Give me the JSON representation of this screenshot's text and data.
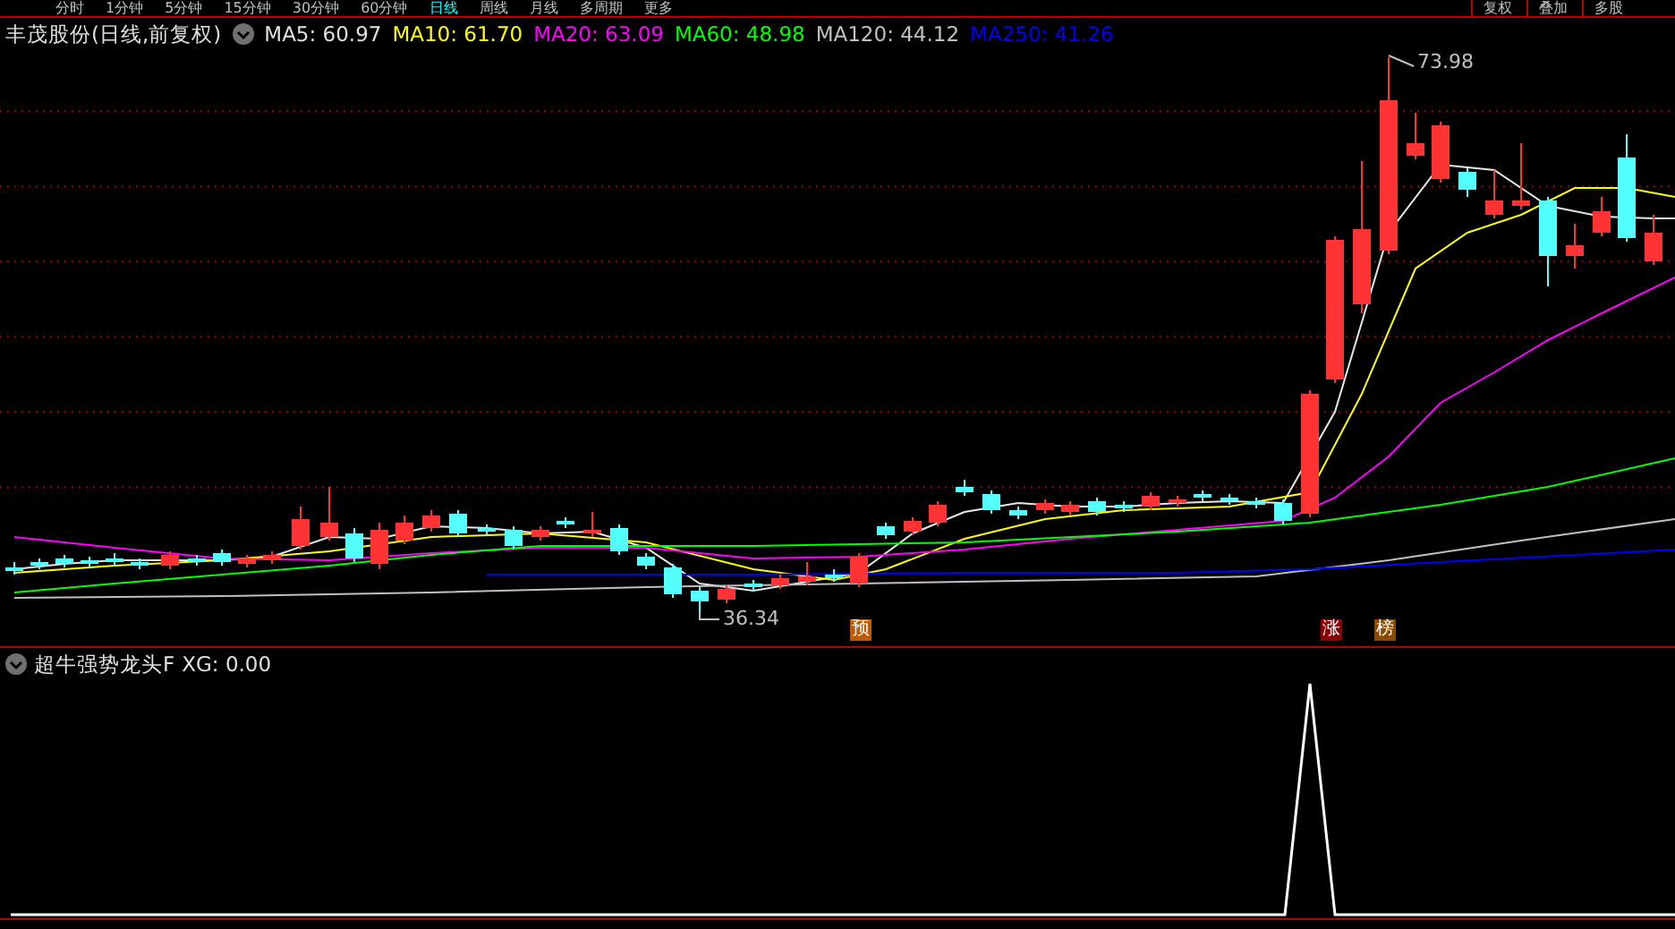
{
  "toolbar": {
    "periods": [
      {
        "label": "分时",
        "selected": false
      },
      {
        "label": "1分钟",
        "selected": false
      },
      {
        "label": "5分钟",
        "selected": false
      },
      {
        "label": "15分钟",
        "selected": false
      },
      {
        "label": "30分钟",
        "selected": false
      },
      {
        "label": "60分钟",
        "selected": false
      },
      {
        "label": "日线",
        "selected": true
      },
      {
        "label": "周线",
        "selected": false
      },
      {
        "label": "月线",
        "selected": false
      },
      {
        "label": "多周期",
        "selected": false
      },
      {
        "label": "更多",
        "selected": false
      }
    ],
    "buttons": [
      "复权",
      "叠加",
      "多股"
    ]
  },
  "chart_header": {
    "title": "丰茂股份(日线,前复权)",
    "indicators": [
      {
        "label": "MA5: 60.97",
        "color": "#e0e0e0"
      },
      {
        "label": "MA10: 61.70",
        "color": "#ffff00"
      },
      {
        "label": "MA20: 63.09",
        "color": "#ff00ff"
      },
      {
        "label": "MA60: 48.98",
        "color": "#00ff00"
      },
      {
        "label": "MA120: 44.12",
        "color": "#c0c0c0"
      },
      {
        "label": "MA250: 41.26",
        "color": "#0000ff"
      }
    ]
  },
  "price_labels": {
    "high": "73.98",
    "low": "36.34"
  },
  "markers": [
    {
      "label": "预",
      "color": "#c05a00"
    },
    {
      "label": "涨",
      "color": "#8b0000"
    },
    {
      "label": "榜",
      "color": "#8b4a00"
    }
  ],
  "indicator_panel": {
    "title": "超牛强势龙头F",
    "reading": "XG: 0.00"
  }
}
